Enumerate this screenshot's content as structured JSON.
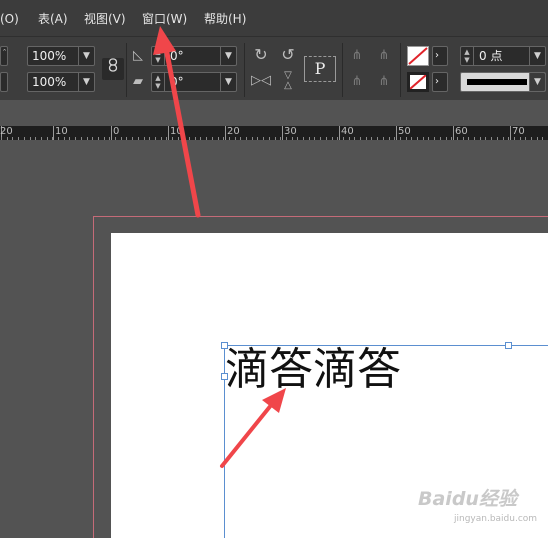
{
  "menubar": {
    "items": [
      "文字(O)",
      "表(A)",
      "视图(V)",
      "窗口(W)",
      "帮助(H)"
    ],
    "visible_fragment": "(O)",
    "active_item": "窗口(W)"
  },
  "control_panel": {
    "scale_x": "100%",
    "scale_y": "100%",
    "rotation_angle": "0°",
    "shear_angle": "0°",
    "frame_type_glyph": "P",
    "stroke_weight": "0 点"
  },
  "ruler": {
    "labels": [
      "20",
      "10",
      "0",
      "10",
      "20",
      "30",
      "40",
      "50",
      "60",
      "70"
    ]
  },
  "document": {
    "frame_text": "滴答滴答"
  },
  "watermark": {
    "brand": "Baidu经验",
    "url": "jingyan.baidu.com"
  },
  "colors": {
    "annotation_arrow": "#f0464a",
    "bleed_guide": "#c56b78",
    "frame_edge": "#5b8fd0"
  },
  "icons": {
    "chain_link": "link-icon",
    "rotate_cw": "rotate-clockwise-icon",
    "rotate_ccw": "rotate-counterclockwise-icon",
    "flip_h": "flip-horizontal-icon",
    "flip_v": "flip-vertical-icon",
    "fill": "fill-swatch-none-icon",
    "stroke": "stroke-swatch-none-icon"
  }
}
